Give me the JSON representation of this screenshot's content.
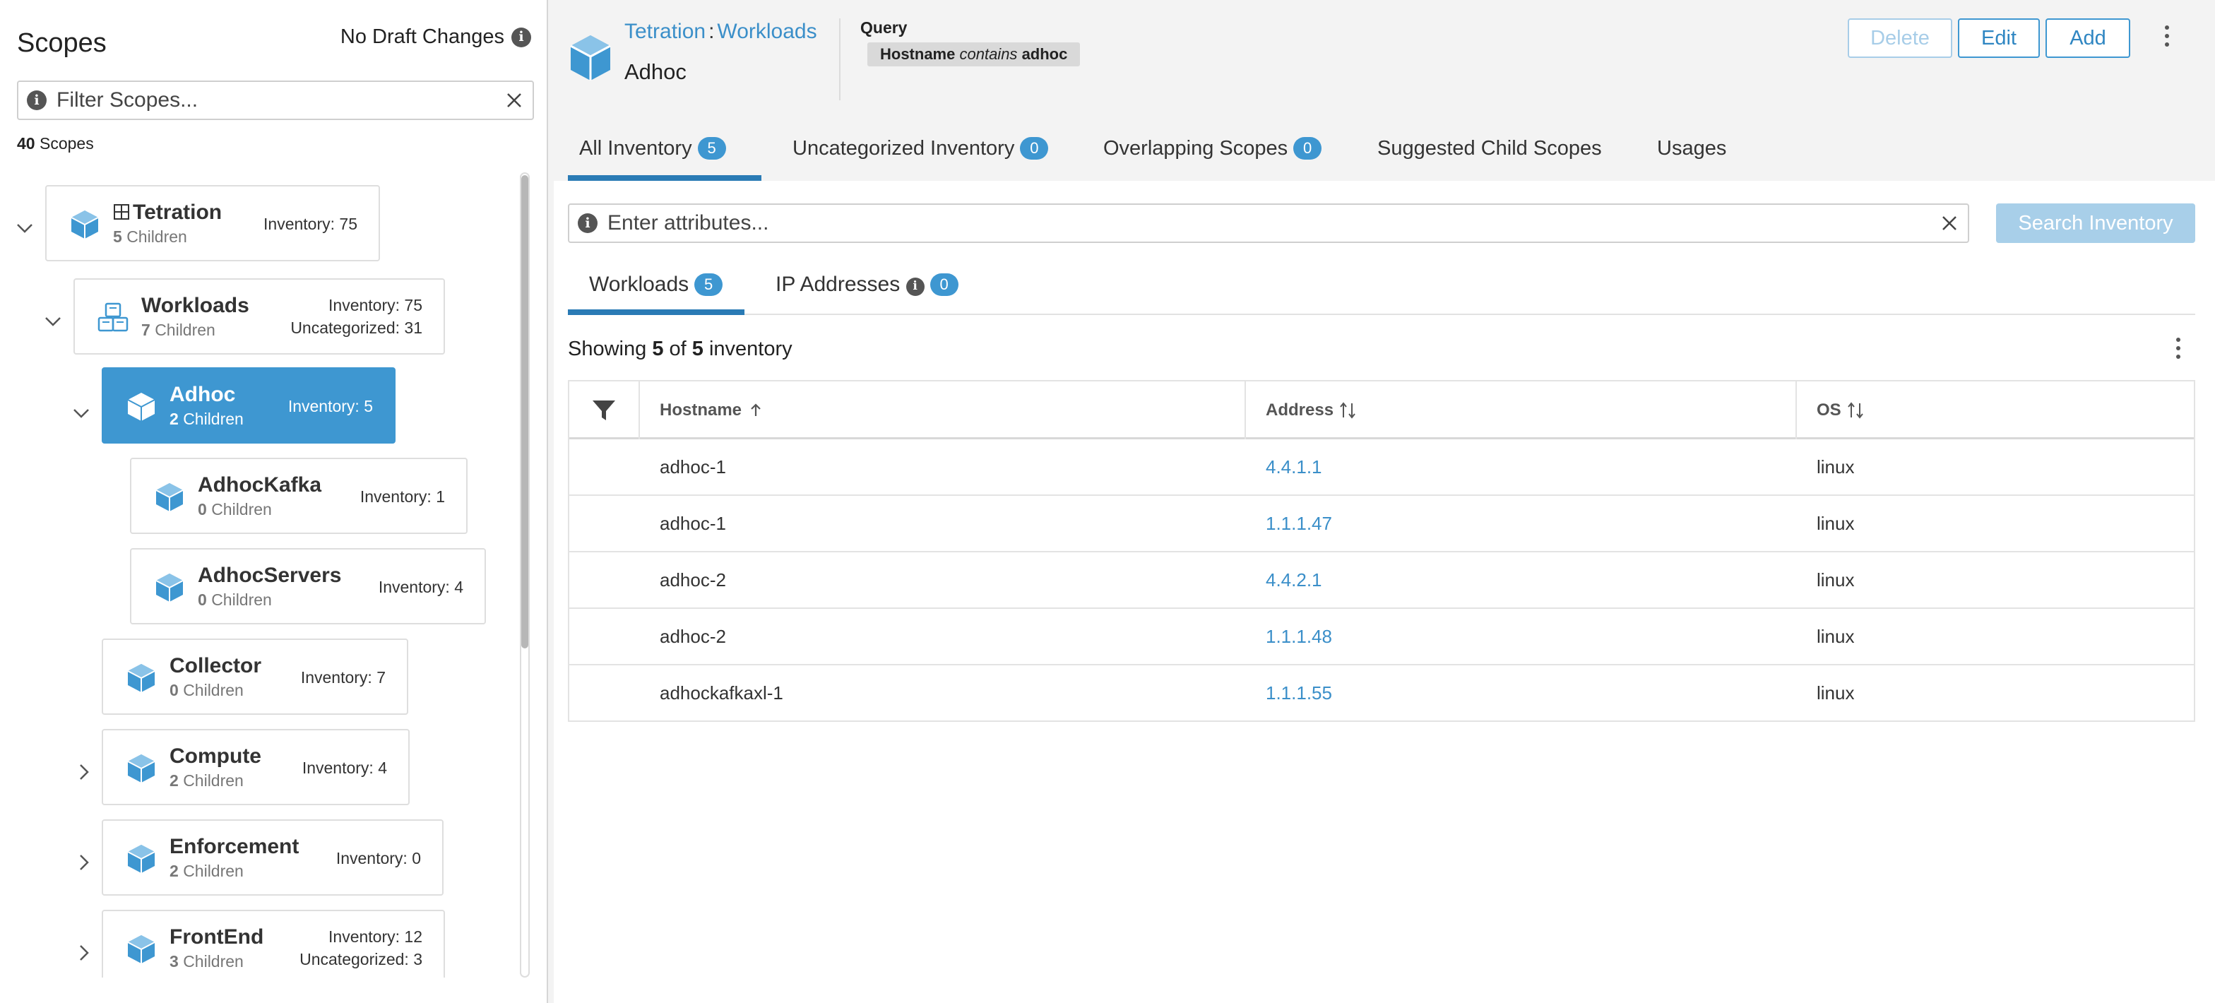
{
  "left": {
    "title": "Scopes",
    "draft_status": "No Draft Changes",
    "filter_placeholder": "Filter Scopes...",
    "scope_count": "40",
    "scope_count_label": "Scopes"
  },
  "tree": {
    "tetration": {
      "name": "Tetration",
      "children_count": "5",
      "children_label": "Children",
      "inventory": "Inventory: 75"
    },
    "workloads": {
      "name": "Workloads",
      "children_count": "7",
      "children_label": "Children",
      "inventory": "Inventory: 75",
      "uncategorized": "Uncategorized: 31"
    },
    "adhoc": {
      "name": "Adhoc",
      "children_count": "2",
      "children_label": "Children",
      "inventory": "Inventory: 5"
    },
    "adhockafka": {
      "name": "AdhocKafka",
      "children_count": "0",
      "children_label": "Children",
      "inventory": "Inventory: 1"
    },
    "adhocservers": {
      "name": "AdhocServers",
      "children_count": "0",
      "children_label": "Children",
      "inventory": "Inventory: 4"
    },
    "collector": {
      "name": "Collector",
      "children_count": "0",
      "children_label": "Children",
      "inventory": "Inventory: 7"
    },
    "compute": {
      "name": "Compute",
      "children_count": "2",
      "children_label": "Children",
      "inventory": "Inventory: 4"
    },
    "enforcement": {
      "name": "Enforcement",
      "children_count": "2",
      "children_label": "Children",
      "inventory": "Inventory: 0"
    },
    "frontend": {
      "name": "FrontEnd",
      "children_count": "3",
      "children_label": "Children",
      "inventory": "Inventory: 12",
      "uncategorized": "Uncategorized: 3"
    }
  },
  "header": {
    "crumb_root": "Tetration",
    "crumb_sep": ":",
    "crumb_child": "Workloads",
    "scope_name": "Adhoc",
    "query_label": "Query",
    "query_field": "Hostname",
    "query_op": "contains",
    "query_value": "adhoc",
    "delete_label": "Delete",
    "edit_label": "Edit",
    "add_label": "Add"
  },
  "tabs": [
    {
      "label": "All Inventory",
      "badge": "5"
    },
    {
      "label": "Uncategorized Inventory",
      "badge": "0"
    },
    {
      "label": "Overlapping Scopes",
      "badge": "0"
    },
    {
      "label": "Suggested Child Scopes"
    },
    {
      "label": "Usages"
    }
  ],
  "inventory": {
    "attr_placeholder": "Enter attributes...",
    "search_label": "Search Inventory",
    "subtabs": [
      {
        "label": "Workloads",
        "badge": "5"
      },
      {
        "label": "IP Addresses",
        "badge": "0"
      }
    ],
    "showing_prefix": "Showing",
    "showing_count": "5",
    "showing_of": "of",
    "showing_total": "5",
    "showing_suffix": "inventory",
    "columns": {
      "hostname": "Hostname",
      "address": "Address",
      "os": "OS"
    },
    "rows": [
      {
        "hostname": "adhoc-1",
        "address": "4.4.1.1",
        "os": "linux"
      },
      {
        "hostname": "adhoc-1",
        "address": "1.1.1.47",
        "os": "linux"
      },
      {
        "hostname": "adhoc-2",
        "address": "4.4.2.1",
        "os": "linux"
      },
      {
        "hostname": "adhoc-2",
        "address": "1.1.1.48",
        "os": "linux"
      },
      {
        "hostname": "adhockafkaxl-1",
        "address": "1.1.1.55",
        "os": "linux"
      }
    ]
  },
  "colors": {
    "accent": "#3e97d1",
    "link": "#3b8fc9",
    "active_tab": "#2a7bb5",
    "disabled": "#a8cfe9"
  }
}
